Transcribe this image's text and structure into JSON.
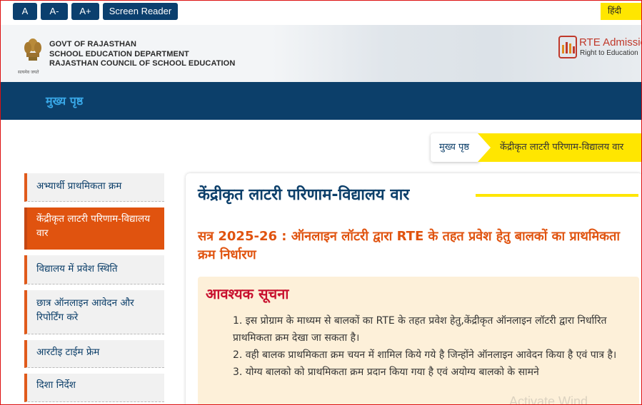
{
  "accessibility": {
    "buttons": [
      "A",
      "A-",
      "A+",
      "Screen Reader"
    ],
    "language_toggle": "हिंदी"
  },
  "header": {
    "line1": "GOVT OF RAJASTHAN",
    "line2": "SCHOOL EDUCATION DEPARTMENT",
    "line3": "RAJASTHAN COUNCIL OF SCHOOL EDUCATION",
    "emblem_caption": "सत्यमेव जयते",
    "rte_title": "RTE Admissio",
    "rte_subtitle": "Right to Education"
  },
  "nav": {
    "home": "मुख्य पृष्ठ"
  },
  "breadcrumb": {
    "home": "मुख्य पृष्ठ",
    "current": "केंद्रीकृत लाटरी परिणाम-विद्यालय वार"
  },
  "sidebar": {
    "items": [
      "अभ्यार्थी प्राथमिकता क्रम",
      "केंद्रीकृत लाटरी परिणाम-विद्यालय वार",
      "विद्यालय में प्रवेश स्थिति",
      "छात्र ऑनलाइन आवेदन और रिपोर्टिंग करे",
      "आरटीइ टाईम फ्रेम",
      "दिशा निर्देश"
    ]
  },
  "main": {
    "title": "केंद्रीकृत लाटरी परिणाम-विद्यालय वार",
    "subtitle": "सत्र 2025-26 : ऑनलाइन लॉटरी द्वारा RTE के तहत प्रवेश हेतु बालकों का प्राथमिकता क्रम निर्धारण",
    "notice_title": "आवश्यक सूचना",
    "notice_points": [
      "1. इस प्रोग्राम के माध्यम से बालकों का RTE के तहत प्रवेश हेतु,केंद्रीकृत ऑनलाइन लॉटरी द्वारा निर्धारित प्राथमिकता क्रम देखा जा सकता है।",
      "2. वही बालक प्राथमिकता क्रम चयन में शामिल किये गये है जिन्होंने ऑनलाइन आवेदन किया है एवं पात्र है।",
      "3. योग्य बालको को प्राथमिकता क्रम प्रदान किया गया है एवं अयोग्य बालको के सामने"
    ]
  },
  "watermark": "Activate Wind",
  "colors": {
    "navy": "#0c3f6a",
    "accent_orange": "#e0530f",
    "yellow": "#ffe600",
    "notice_bg": "#fdf0d9",
    "notice_title": "#c8102e"
  }
}
